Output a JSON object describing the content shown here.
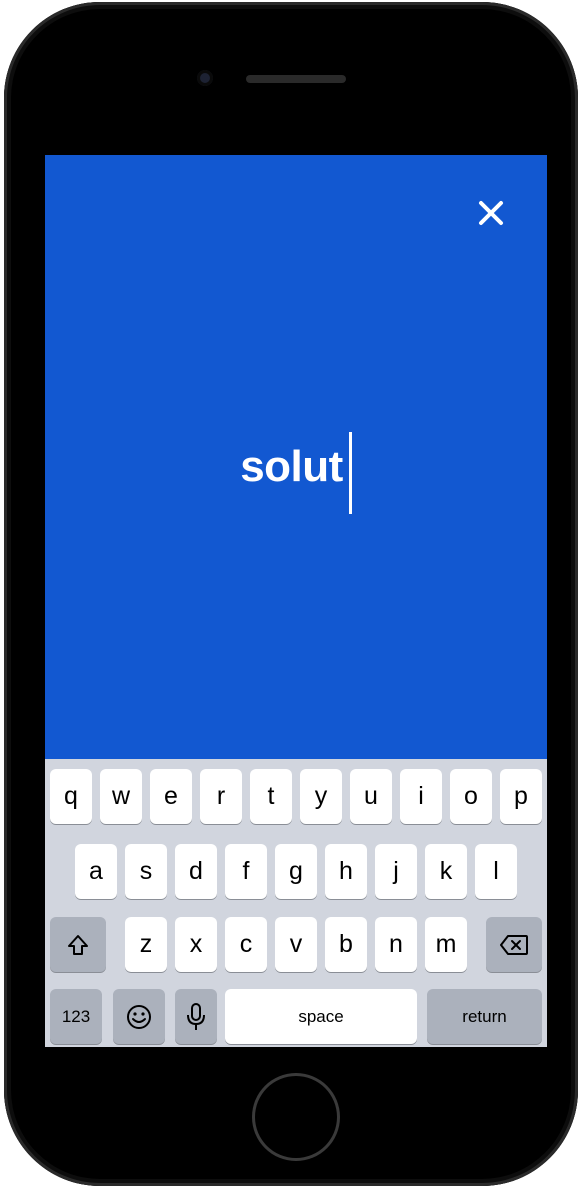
{
  "screen": {
    "background_color": "#1258d1",
    "close_icon": "close-icon",
    "typed_text": "solut"
  },
  "keyboard": {
    "row1": [
      "q",
      "w",
      "e",
      "r",
      "t",
      "y",
      "u",
      "i",
      "o",
      "p"
    ],
    "row2": [
      "a",
      "s",
      "d",
      "f",
      "g",
      "h",
      "j",
      "k",
      "l"
    ],
    "row3": [
      "z",
      "x",
      "c",
      "v",
      "b",
      "n",
      "m"
    ],
    "shift_icon": "shift-icon",
    "delete_icon": "delete-icon",
    "numbers_label": "123",
    "emoji_icon": "emoji-icon",
    "mic_icon": "microphone-icon",
    "space_label": "space",
    "return_label": "return"
  }
}
